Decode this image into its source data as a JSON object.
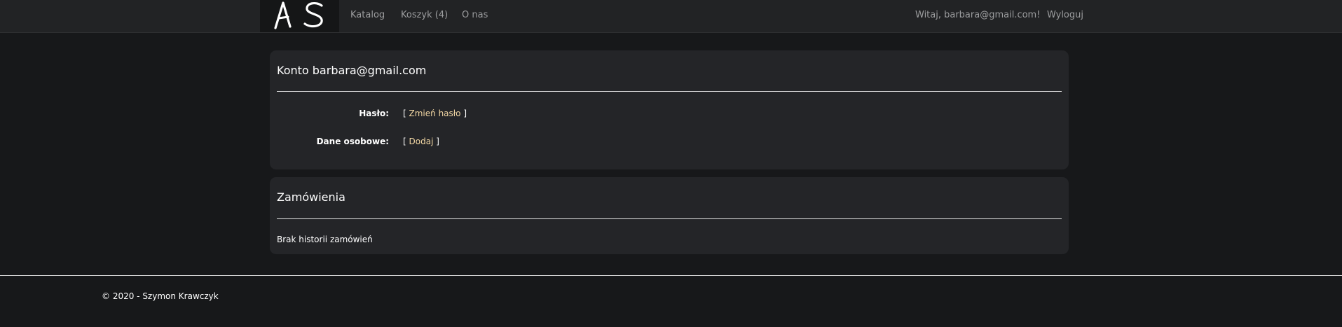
{
  "navbar": {
    "brand_logo_text": "AS",
    "links": {
      "catalog": "Katalog",
      "cart": "Koszyk (4)",
      "about": "O nas"
    },
    "greeting": "Witaj, barbara@gmail.com!",
    "logout": "Wyloguj"
  },
  "account": {
    "title": "Konto barbara@gmail.com",
    "password_label": "Hasło:",
    "password_link": "Zmień hasło",
    "personal_label": "Dane osobowe:",
    "personal_link": "Dodaj",
    "bracket_open": "[",
    "bracket_close": "]"
  },
  "orders": {
    "title": "Zamówienia",
    "empty_text": "Brak historii zamówień"
  },
  "footer": {
    "copyright": "© 2020 - Szymon Krawczyk"
  },
  "colors": {
    "page_background": "#17181a",
    "navbar_background": "#222325",
    "card_background": "#242528",
    "link_accent": "#f2d7a4",
    "nav_text": "#9c9d9f"
  }
}
